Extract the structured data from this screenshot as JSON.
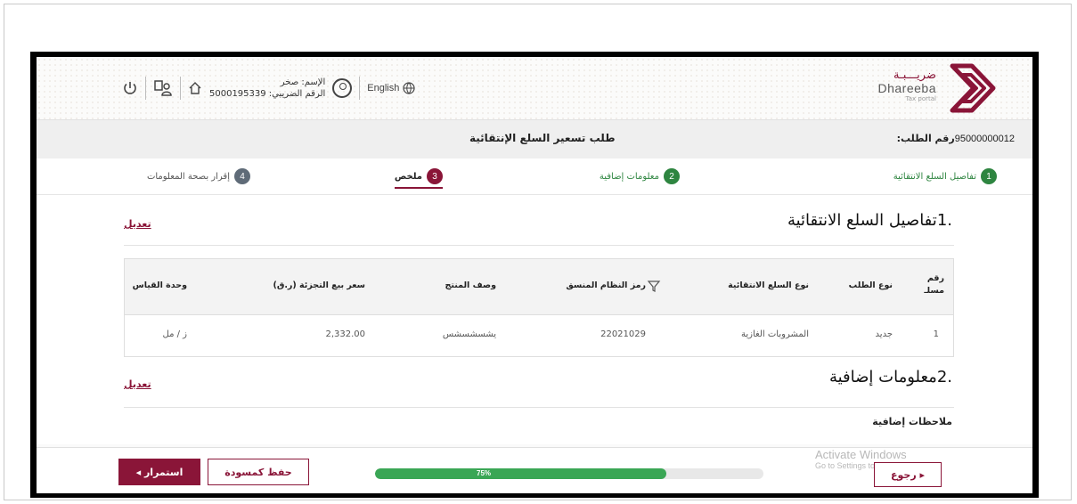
{
  "header": {
    "logo_ar": "ضريـــبـة",
    "logo_en": "Dhareeba",
    "logo_sub": "Tax portal",
    "language": "English",
    "user_name": "الإسم: صخر",
    "tax_id": "الرقم الضريبي: 5000195339"
  },
  "request": {
    "number_label": "رقم الطلب:",
    "number_value": "95000000012",
    "title": "طلب تسعير السلع الإنتقائية"
  },
  "steps": [
    {
      "num": "1",
      "label": "تفاصيل السلع الانتقائية",
      "state": "done"
    },
    {
      "num": "2",
      "label": "معلومات إضافية",
      "state": "done"
    },
    {
      "num": "3",
      "label": "ملخص",
      "state": "active"
    },
    {
      "num": "4",
      "label": "إقرار بصحة المعلومات",
      "state": "todo"
    }
  ],
  "section1": {
    "title": ".1تفاصيل السلع الانتقائية",
    "edit": "تعديل"
  },
  "table": {
    "headers": {
      "serial": "رقم مسلـ",
      "request_type": "نوع الطلب",
      "goods_type": "نوع السلع الانتقائية",
      "hs_code": "رمز النظام المنسق",
      "product_desc": "وصف المنتج",
      "retail_price": "سعر بيع التجزئة (ر.ق)",
      "unit": "وحدة القياس"
    },
    "row": {
      "serial": "1",
      "request_type": "جديد",
      "goods_type": "المشروبات الغازية",
      "hs_code": "22021029",
      "product_desc": "يشسشسشس",
      "retail_price": "2,332.00",
      "unit": "ز / مل"
    }
  },
  "section2": {
    "title": ".2معلومات إضافية",
    "edit": "تعديل",
    "notes_label": "ملاحظات إضافية"
  },
  "footer": {
    "continue": "استمرار ◂",
    "save_draft": "حفظ كمسودة",
    "back": "▸ رجوع",
    "progress_text": "75%",
    "progress": 0.75
  },
  "watermark": {
    "line1": "Activate Windows",
    "line2": "Go to Settings to activate Windows."
  },
  "colors": {
    "brand": "#8a1538",
    "success": "#2e8540",
    "progress": "#3aa655"
  }
}
